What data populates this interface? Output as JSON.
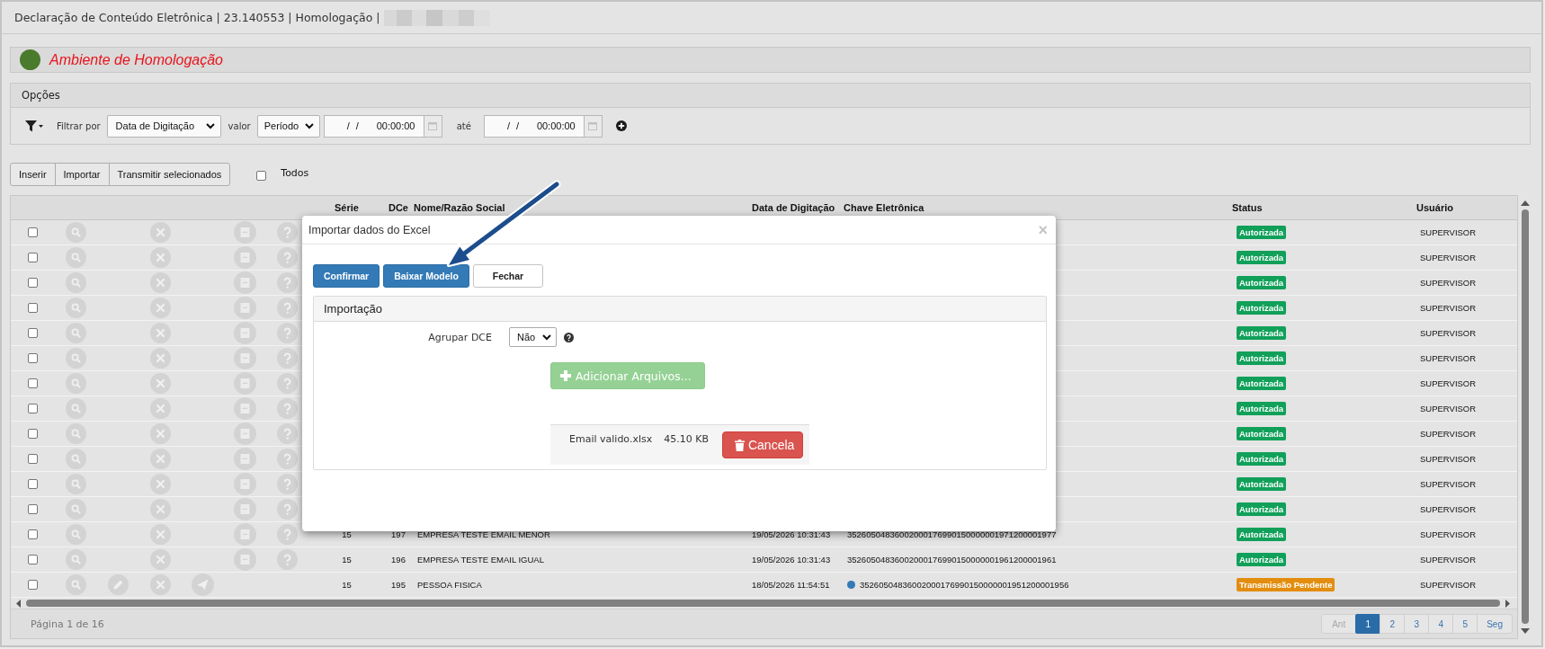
{
  "window": {
    "title": "Declaração de Conteúdo Eletrônica | 23.140553 | Homologação |"
  },
  "environment": {
    "label": "Ambiente de Homologação"
  },
  "options": {
    "title": "Opções",
    "filter_label": "Filtrar por",
    "filter_field": "Data de Digitação",
    "value_label": "valor",
    "value_mode": "Período",
    "date_from": {
      "date": "/ /",
      "time": "00:00:00"
    },
    "until_label": "até",
    "date_to": {
      "date": "/ /",
      "time": "00:00:00"
    }
  },
  "toolbar": {
    "buttons": [
      "Inserir",
      "Importar",
      "Transmitir selecionados"
    ],
    "select_all": {
      "label": "Todos",
      "checked": false
    }
  },
  "table": {
    "columns": [
      "Série",
      "DCe",
      "Nome/Razão Social",
      "Data de Digitação",
      "Chave Eletrônica",
      "Status",
      "Usuário"
    ],
    "rows": [
      {
        "kind": "authorized",
        "checked": false,
        "status": {
          "label": "Autorizada",
          "color": "#11a05a"
        },
        "user": "SUPERVISOR"
      },
      {
        "kind": "authorized",
        "checked": false,
        "status": {
          "label": "Autorizada",
          "color": "#11a05a"
        },
        "user": "SUPERVISOR"
      },
      {
        "kind": "authorized",
        "checked": false,
        "status": {
          "label": "Autorizada",
          "color": "#11a05a"
        },
        "user": "SUPERVISOR"
      },
      {
        "kind": "authorized",
        "checked": false,
        "status": {
          "label": "Autorizada",
          "color": "#11a05a"
        },
        "user": "SUPERVISOR"
      },
      {
        "kind": "authorized",
        "checked": false,
        "status": {
          "label": "Autorizada",
          "color": "#11a05a"
        },
        "user": "SUPERVISOR"
      },
      {
        "kind": "authorized",
        "checked": false,
        "status": {
          "label": "Autorizada",
          "color": "#11a05a"
        },
        "user": "SUPERVISOR"
      },
      {
        "kind": "authorized",
        "checked": false,
        "status": {
          "label": "Autorizada",
          "color": "#11a05a"
        },
        "user": "SUPERVISOR"
      },
      {
        "kind": "authorized",
        "checked": false,
        "status": {
          "label": "Autorizada",
          "color": "#11a05a"
        },
        "user": "SUPERVISOR"
      },
      {
        "kind": "authorized",
        "checked": false,
        "status": {
          "label": "Autorizada",
          "color": "#11a05a"
        },
        "user": "SUPERVISOR"
      },
      {
        "kind": "authorized",
        "checked": false,
        "status": {
          "label": "Autorizada",
          "color": "#11a05a"
        },
        "user": "SUPERVISOR"
      },
      {
        "kind": "authorized",
        "checked": false,
        "status": {
          "label": "Autorizada",
          "color": "#11a05a"
        },
        "user": "SUPERVISOR"
      },
      {
        "kind": "authorized",
        "checked": false,
        "status": {
          "label": "Autorizada",
          "color": "#11a05a"
        },
        "user": "SUPERVISOR"
      },
      {
        "kind": "authorized",
        "checked": false,
        "serie": "15",
        "dce": "197",
        "name": "EMPRESA TESTE EMAIL MENOR",
        "date": "19/05/2026 10:31:43",
        "key": {
          "text": "35260504836002000176990150000001971200001977",
          "dot": false
        },
        "status": {
          "label": "Autorizada",
          "color": "#11a05a"
        },
        "user": "SUPERVISOR"
      },
      {
        "kind": "authorized",
        "checked": false,
        "serie": "15",
        "dce": "196",
        "name": "EMPRESA TESTE EMAIL IGUAL",
        "date": "19/05/2026 10:31:43",
        "key": {
          "text": "35260504836002000176990150000001961200001961",
          "dot": false
        },
        "status": {
          "label": "Autorizada",
          "color": "#11a05a"
        },
        "user": "SUPERVISOR"
      },
      {
        "kind": "pending",
        "checked": false,
        "serie": "15",
        "dce": "195",
        "name": "PESSOA FISICA",
        "date": "18/05/2026 11:54:51",
        "key": {
          "text": "35260504836002000176990150000001951200001956",
          "dot": true
        },
        "status": {
          "label": "Transmissão Pendente",
          "color": "#e38d0f"
        },
        "user": "SUPERVISOR"
      }
    ]
  },
  "footer": {
    "page_info": "Página 1 de 16",
    "pages": [
      {
        "label": "Ant",
        "selected": false,
        "disabled": true
      },
      {
        "label": "1",
        "selected": true,
        "disabled": false
      },
      {
        "label": "2",
        "selected": false,
        "disabled": false
      },
      {
        "label": "3",
        "selected": false,
        "disabled": false
      },
      {
        "label": "4",
        "selected": false,
        "disabled": false
      },
      {
        "label": "5",
        "selected": false,
        "disabled": false
      },
      {
        "label": "Seg",
        "selected": false,
        "disabled": false
      }
    ]
  },
  "modal": {
    "title": "Importar dados do Excel",
    "close": "×",
    "buttons": [
      {
        "label": "Confirmar",
        "kind": "primary"
      },
      {
        "label": "Baixar Modelo",
        "kind": "primary"
      },
      {
        "label": "Fechar",
        "kind": "default"
      }
    ],
    "panel": {
      "title": "Importação",
      "group_label": "Agrupar DCE",
      "group_value": "Não",
      "add_button": {
        "label": "Adicionar Arquivos...",
        "disabled": true
      },
      "files": [
        {
          "name": "Email valido.xlsx",
          "size": "45.10 KB",
          "cancel_label": "Cancela"
        }
      ]
    }
  }
}
